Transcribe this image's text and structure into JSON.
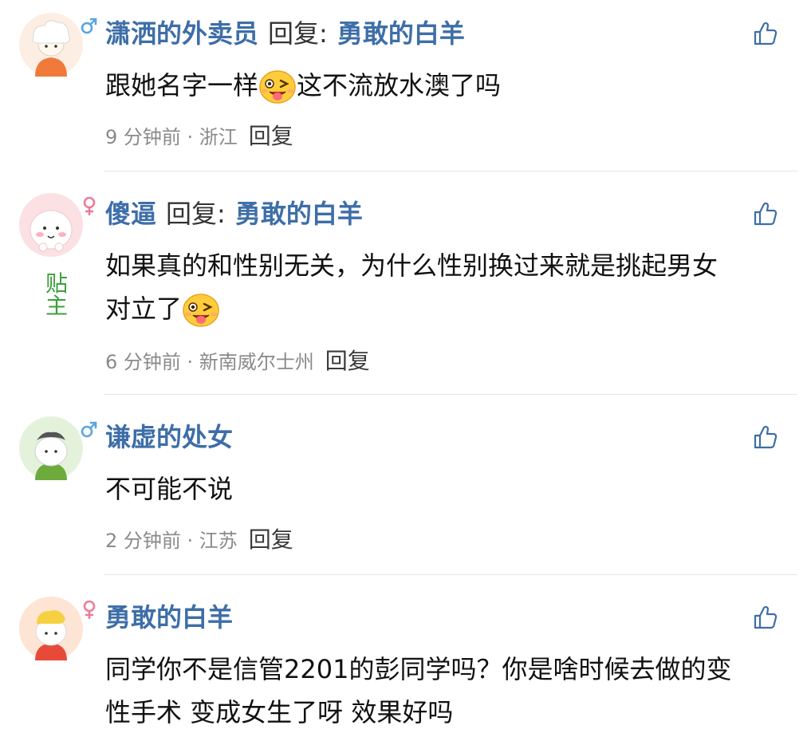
{
  "comments": [
    {
      "avatar": "cloud-head-avatar-orange",
      "gender": "male",
      "name": "潇洒的外卖员",
      "reply_word": "回复:",
      "reply_target": "勇敢的白羊",
      "content_parts": [
        "跟她名字一样",
        "这不流放水澳了吗"
      ],
      "emoji": "wink-tongue-emoji",
      "time": "9 分钟前",
      "location": "浙江",
      "reply_label": "回复"
    },
    {
      "avatar": "cloud-head-avatar-pink",
      "gender": "female",
      "badge": "贴主",
      "name": "傻逼",
      "reply_word": "回复:",
      "reply_target": "勇敢的白羊",
      "content_line1": "如果真的和性别无关，为什么性别换过来就是挑起男女",
      "content_line2": "对立了",
      "emoji": "wink-tongue-emoji",
      "time": "6 分钟前",
      "location": "新南威尔士州",
      "reply_label": "回复"
    },
    {
      "avatar": "cloud-head-avatar-green",
      "gender": "male",
      "name": "谦虚的处女",
      "content": "不可能不说",
      "time": "2 分钟前",
      "location": "江苏",
      "reply_label": "回复"
    },
    {
      "avatar": "cloud-head-avatar-red",
      "gender": "female",
      "name": "勇敢的白羊",
      "content_line1": "同学你不是信管2201的彭同学吗？你是啥时候去做的变",
      "content_line2": "性手术 变成女生了呀 效果好吗"
    }
  ],
  "colors": {
    "username": "#3d6ea8",
    "male": "#5aa6e0",
    "female": "#f07a9a",
    "poster_badge": "#3aa03a",
    "meta": "#8a8a8a"
  },
  "separator": " · ",
  "icons": [
    "thumbs-up-icon",
    "male-icon",
    "female-icon"
  ]
}
